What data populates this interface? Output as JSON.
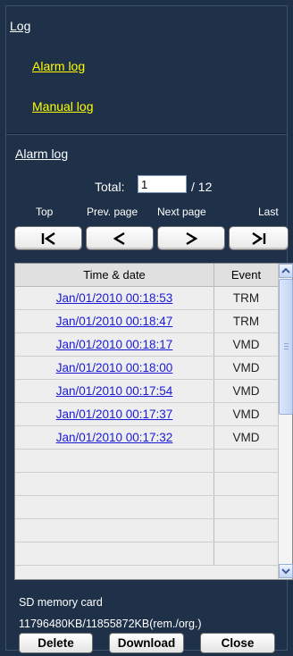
{
  "menu": {
    "log_label": "Log",
    "alarm_log_label": "Alarm log",
    "manual_log_label": "Manual log"
  },
  "section": {
    "title": "Alarm log",
    "total_label": "Total:",
    "page_value": "1",
    "page_total": "/ 12"
  },
  "nav": {
    "top_label": "Top",
    "prev_label": "Prev. page",
    "next_label": "Next page",
    "last_label": "Last"
  },
  "table": {
    "headers": {
      "time": "Time & date",
      "event": "Event"
    },
    "rows": [
      {
        "time": "Jan/01/2010 00:18:53",
        "event": "TRM"
      },
      {
        "time": "Jan/01/2010 00:18:47",
        "event": "TRM"
      },
      {
        "time": "Jan/01/2010 00:18:17",
        "event": "VMD"
      },
      {
        "time": "Jan/01/2010 00:18:00",
        "event": "VMD"
      },
      {
        "time": "Jan/01/2010 00:17:54",
        "event": "VMD"
      },
      {
        "time": "Jan/01/2010 00:17:37",
        "event": "VMD"
      },
      {
        "time": "Jan/01/2010 00:17:32",
        "event": "VMD"
      },
      {
        "time": "",
        "event": ""
      },
      {
        "time": "",
        "event": ""
      },
      {
        "time": "",
        "event": ""
      },
      {
        "time": "",
        "event": ""
      },
      {
        "time": "",
        "event": ""
      }
    ]
  },
  "sd": {
    "label": "SD memory card",
    "value": "11796480KB/11855872KB(rem./org.)"
  },
  "actions": {
    "delete_label": "Delete",
    "download_label": "Download",
    "close_label": "Close"
  },
  "colors": {
    "background": "#1e3148",
    "link_yellow": "#ffff00",
    "link_blue": "#1a1ad8"
  }
}
